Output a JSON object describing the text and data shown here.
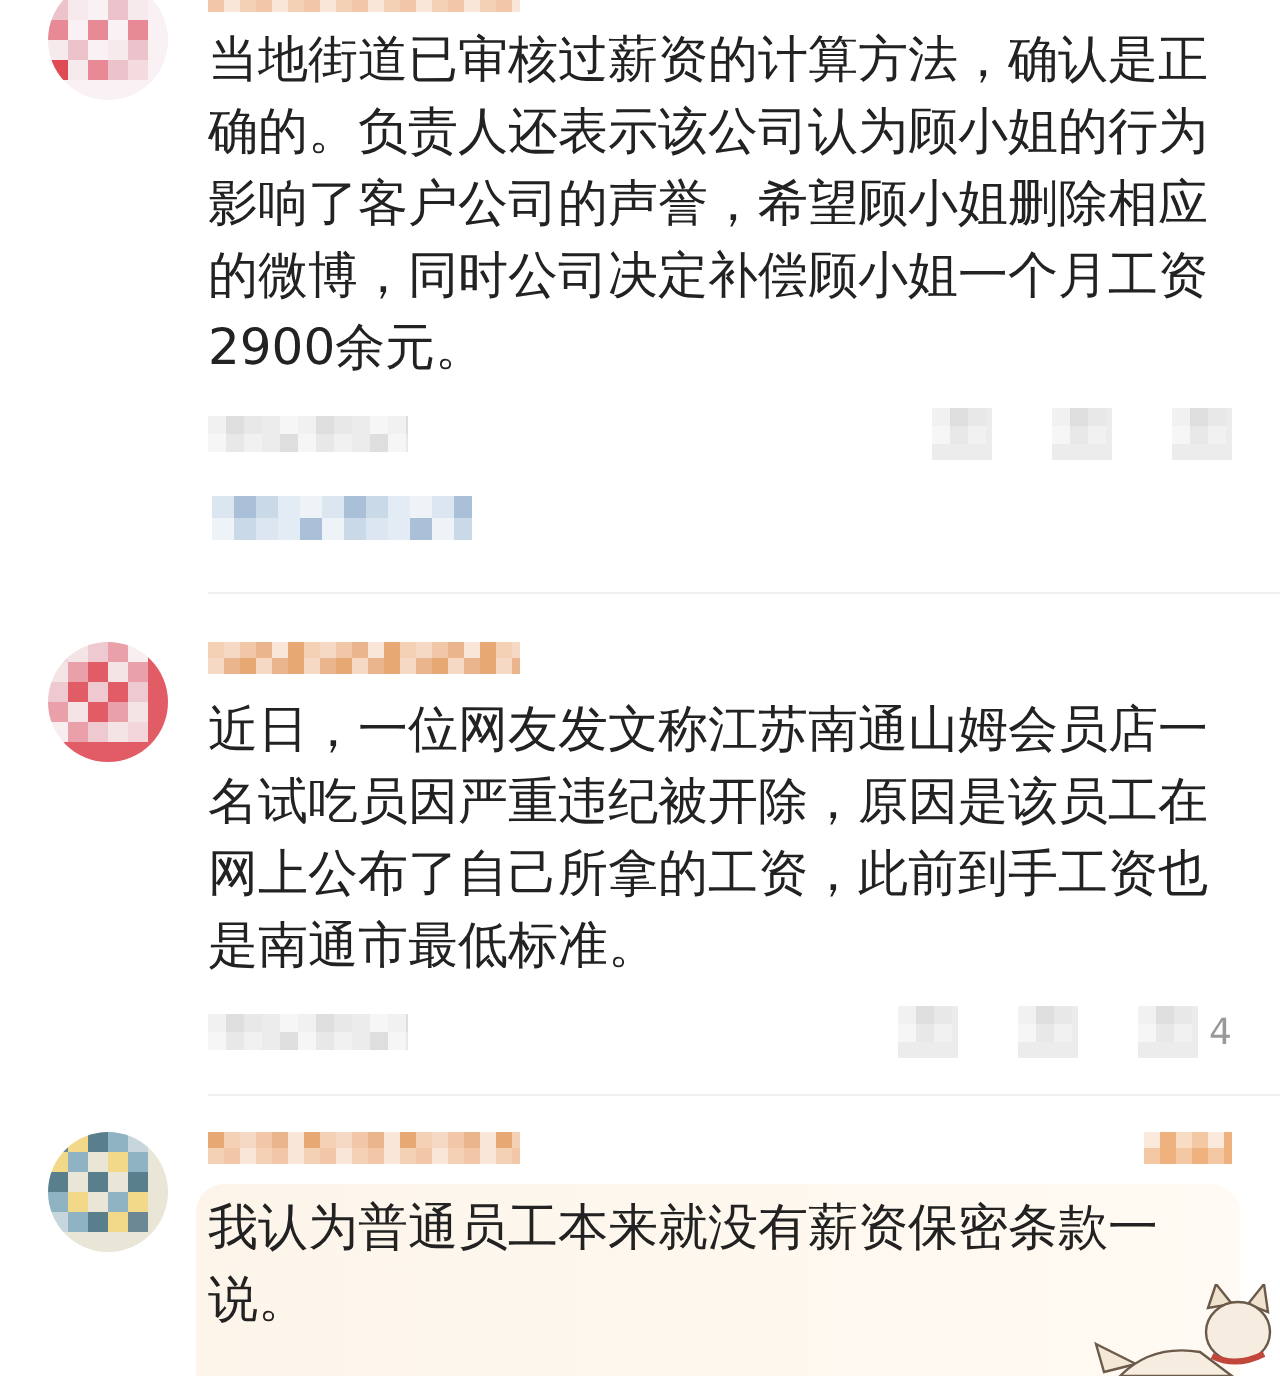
{
  "comments": [
    {
      "kind": "reply_thread",
      "text": "当地街道已审核过薪资的计算方法，确认是正确的。负责人还表示该公司认为顾小姐的行为影响了客户公司的声誉，希望顾小姐删除相应的微博，同时公司决定补偿顾小姐一个月工资2900余元。"
    },
    {
      "kind": "plain",
      "text": "近日，一位网友发文称江苏南通山姆会员店一名试吃员因严重违纪被开除，原因是该员工在网上公布了自己所拿的工资，此前到手工资也是南通市最低标准。",
      "like_count": "4"
    },
    {
      "kind": "highlighted",
      "text": "我认为普通员工本来就没有薪资保密条款一说。"
    }
  ]
}
